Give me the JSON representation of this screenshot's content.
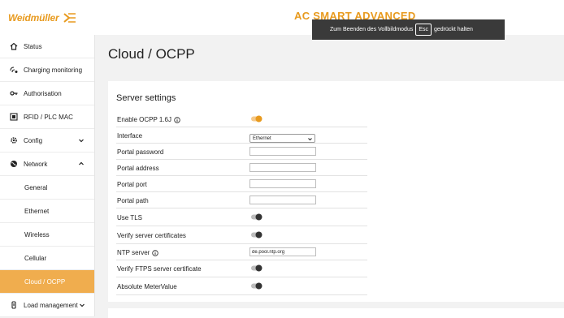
{
  "header": {
    "logo_text": "Weidmüller",
    "app_title": "AC SMART ADVANCED",
    "brand_color": "#e89a1e"
  },
  "toast": {
    "before": "Zum Beenden des Vollbildmodus",
    "key": "Esc",
    "after": "gedrückt halten"
  },
  "sidebar": {
    "items": [
      {
        "label": "Status",
        "icon": "home-icon"
      },
      {
        "label": "Charging monitoring",
        "icon": "charging-icon"
      },
      {
        "label": "Authorisation",
        "icon": "key-icon"
      },
      {
        "label": "RFID / PLC MAC",
        "icon": "rfid-icon"
      },
      {
        "label": "Config",
        "icon": "gear-icon",
        "chevron": "down"
      },
      {
        "label": "Network",
        "icon": "globe-icon",
        "chevron": "up"
      },
      {
        "label": "General"
      },
      {
        "label": "Ethernet"
      },
      {
        "label": "Wireless"
      },
      {
        "label": "Cellular"
      },
      {
        "label": "Cloud / OCPP",
        "active": true
      },
      {
        "label": "Load management",
        "icon": "load-icon",
        "chevron": "down"
      }
    ]
  },
  "main": {
    "page_title": "Cloud / OCPP",
    "server_settings": {
      "title": "Server settings",
      "enable_ocpp_label": "Enable OCPP 1.6J",
      "enable_ocpp_on": true,
      "interface_label": "Interface",
      "interface_value": "Ethernet",
      "portal_password_label": "Portal password",
      "portal_password_value": "",
      "portal_address_label": "Portal address",
      "portal_address_value": "",
      "portal_port_label": "Portal port",
      "portal_port_value": "",
      "portal_path_label": "Portal path",
      "portal_path_value": "",
      "use_tls_label": "Use TLS",
      "use_tls_on": false,
      "verify_certs_label": "Verify server certificates",
      "verify_certs_on": false,
      "ntp_label": "NTP server",
      "ntp_value": "de.pool.ntp.org",
      "verify_ftps_label": "Verify FTPS server certificate",
      "verify_ftps_on": false,
      "absolute_meter_label": "Absolute MeterValue",
      "absolute_meter_on": false
    }
  }
}
